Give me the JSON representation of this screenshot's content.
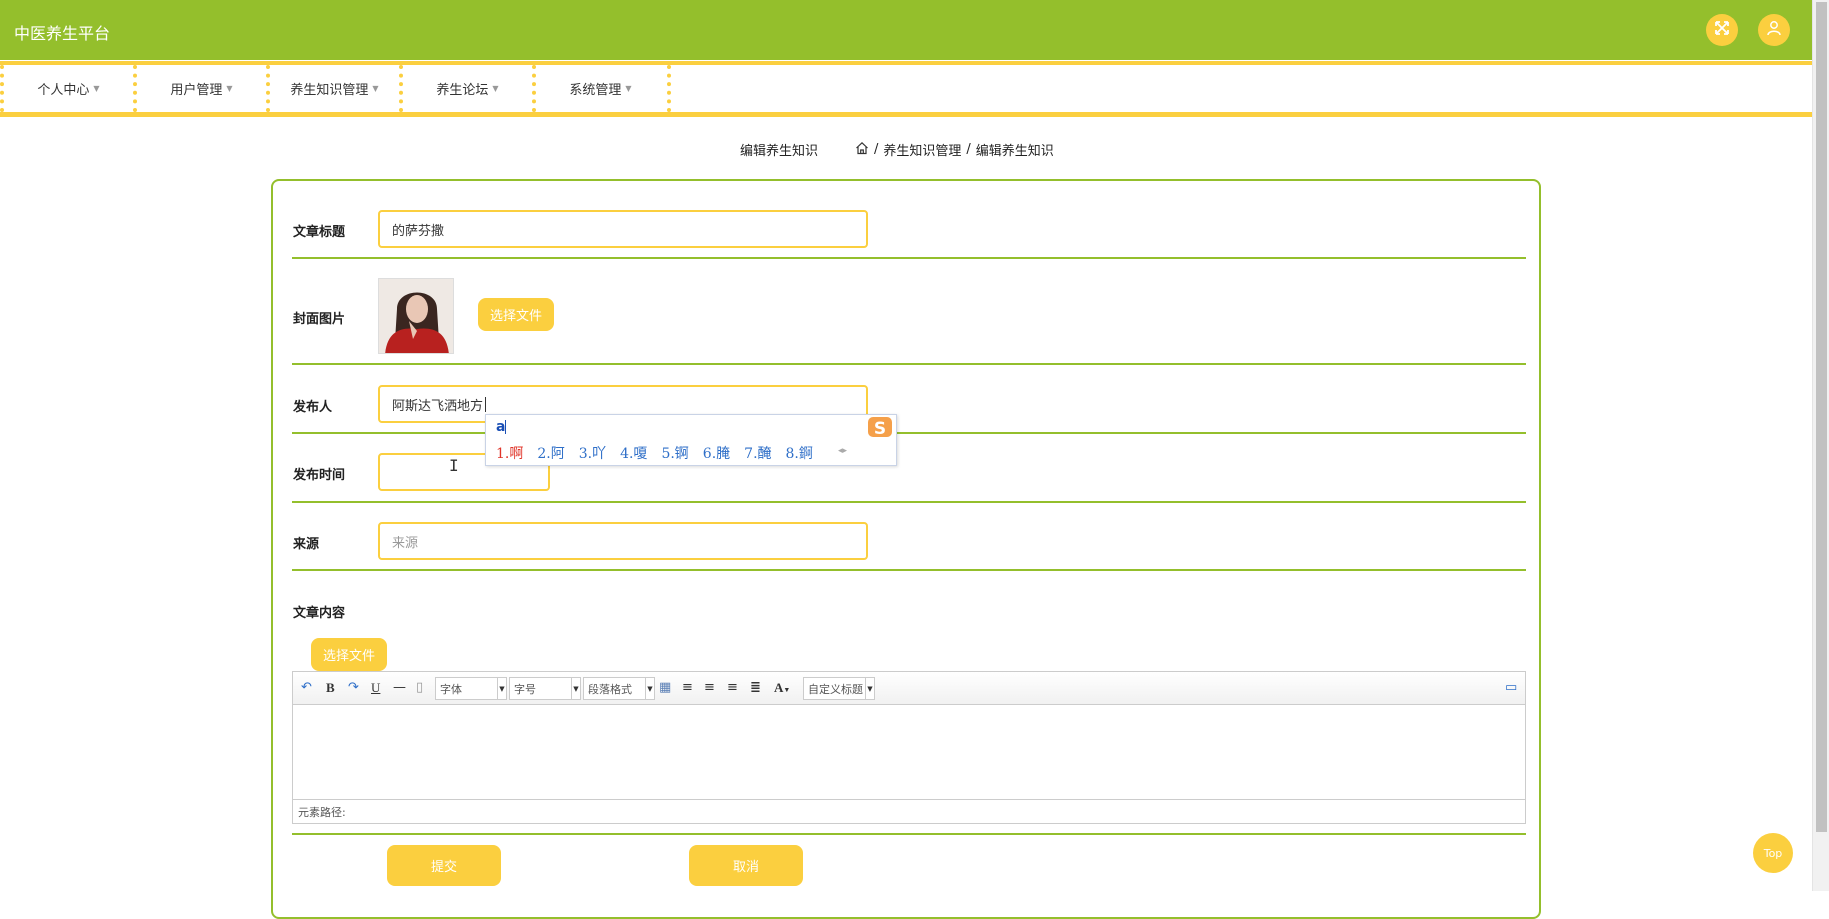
{
  "header": {
    "brand": "中医养生平台",
    "icons": [
      "fullscreen-icon",
      "user-icon"
    ],
    "color": "#94bf2c",
    "accent": "#fbcf3f"
  },
  "nav": [
    {
      "label": "个人中心"
    },
    {
      "label": "用户管理"
    },
    {
      "label": "养生知识管理"
    },
    {
      "label": "养生论坛"
    },
    {
      "label": "系统管理"
    }
  ],
  "breadcrumb": {
    "page_title": "编辑养生知识",
    "sep": "/",
    "items": [
      "养生知识管理",
      "编辑养生知识"
    ]
  },
  "form": {
    "title_label": "文章标题",
    "title_value": "的萨芬撒",
    "cover_label": "封面图片",
    "choose_file": "选择文件",
    "publisher_label": "发布人",
    "publisher_value": "阿斯达飞洒地方",
    "date_label": "发布时间",
    "date_value": "",
    "source_label": "来源",
    "source_placeholder": "来源",
    "content_label": "文章内容",
    "content_choose_file": "选择文件",
    "submit": "提交",
    "cancel": "取消"
  },
  "ime": {
    "pinyin": "a",
    "candidates": [
      "1.啊",
      "2.阿",
      "3.吖",
      "4.嗄",
      "5.锕",
      "6.腌",
      "7.醃",
      "8.錒"
    ]
  },
  "editor": {
    "font_select": "字体",
    "size_select": "字号",
    "paragraph_select": "段落格式",
    "custom_title_select": "自定义标题",
    "path_label": "元素路径:"
  },
  "top_button": "Top"
}
